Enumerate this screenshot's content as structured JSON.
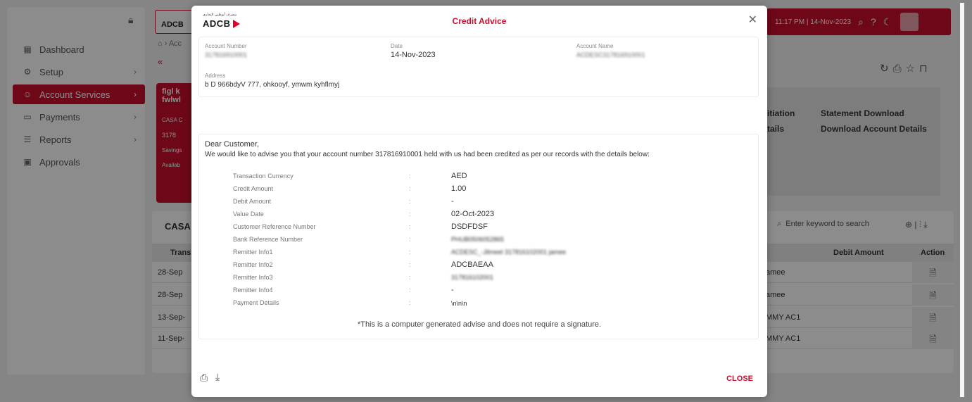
{
  "sidebar": {
    "items": [
      {
        "icon": "dashboard-icon",
        "label": "Dashboard",
        "has_chevron": false
      },
      {
        "icon": "setup-icon",
        "label": "Setup",
        "has_chevron": true
      },
      {
        "icon": "account-services-icon",
        "label": "Account Services",
        "has_chevron": true
      },
      {
        "icon": "payments-icon",
        "label": "Payments",
        "has_chevron": true
      },
      {
        "icon": "reports-icon",
        "label": "Reports",
        "has_chevron": true
      },
      {
        "icon": "approvals-icon",
        "label": "Approvals",
        "has_chevron": false
      }
    ]
  },
  "topbar": {
    "logo_text": "ADCB",
    "datetime": "11:17 PM | 14-Nov-2023"
  },
  "breadcrumb": "⌂ › Acc",
  "account_card": {
    "line1": "figl k",
    "line2": "fwlwl",
    "casa": "CASA C",
    "num": "3178",
    "savings": "Savings",
    "avail": "Availab"
  },
  "quick_links": {
    "initiation": "itiation",
    "details": "tails",
    "statement_download": "Statement Download",
    "download_account_details": "Download Account Details"
  },
  "grid": {
    "title": "CASA",
    "search_placeholder": "Enter keyword to search",
    "headers": {
      "trans": "Trans",
      "debit": "Debit Amount",
      "action": "Action"
    },
    "rows": [
      {
        "date": "28-Sep",
        "desc": "amee"
      },
      {
        "date": "28-Sep",
        "desc": "amee"
      },
      {
        "date": "13-Sep-",
        "desc": "MMY AC1"
      },
      {
        "date": "11-Sep-",
        "desc": "MMY AC1"
      }
    ]
  },
  "modal": {
    "logo": "ADCB",
    "logo_small": "مصرف أبوظبي التجاري",
    "title": "Credit Advice",
    "account_number_label": "Account Number",
    "account_number": "317816910001",
    "date_label": "Date",
    "date": "14-Nov-2023",
    "account_name_label": "Account Name",
    "account_name": "ACDESC317816910001",
    "address_label": "Address",
    "address": "b D 966bdyV 777, ohkooyf, ymwm kyhflmyj",
    "greeting": "Dear Customer,",
    "paragraph": "We would like to advise you that your account number 317816910001 held with us had been credited as per our records with the details below:",
    "details": [
      {
        "label": "Transaction Currency",
        "value": "AED",
        "blurred": false
      },
      {
        "label": "Credit Amount",
        "value": "1.00",
        "blurred": false
      },
      {
        "label": "Debit Amount",
        "value": "-",
        "blurred": false
      },
      {
        "label": "Value Date",
        "value": "02-Oct-2023",
        "blurred": false
      },
      {
        "label": "Customer Reference Number",
        "value": "DSDFDSF",
        "blurred": false
      },
      {
        "label": "Bank Reference Number",
        "value": "PHUB0506052865",
        "blurred": true
      },
      {
        "label": "Remitter Info1",
        "value": "ACDESC_-Jilmeel 317816102001 jamee",
        "blurred": true
      },
      {
        "label": "Remitter Info2",
        "value": "ADCBAEAA",
        "blurred": false
      },
      {
        "label": "Remitter Info3",
        "value": "317816102001",
        "blurred": true
      },
      {
        "label": "Remitter Info4",
        "value": "-",
        "blurred": false
      },
      {
        "label": "Payment Details",
        "value": "\\n\\n\\n",
        "blurred": false
      }
    ],
    "separator": ":",
    "footnote": "*This is a computer generated advise and does not require a signature.",
    "close_label": "CLOSE"
  }
}
